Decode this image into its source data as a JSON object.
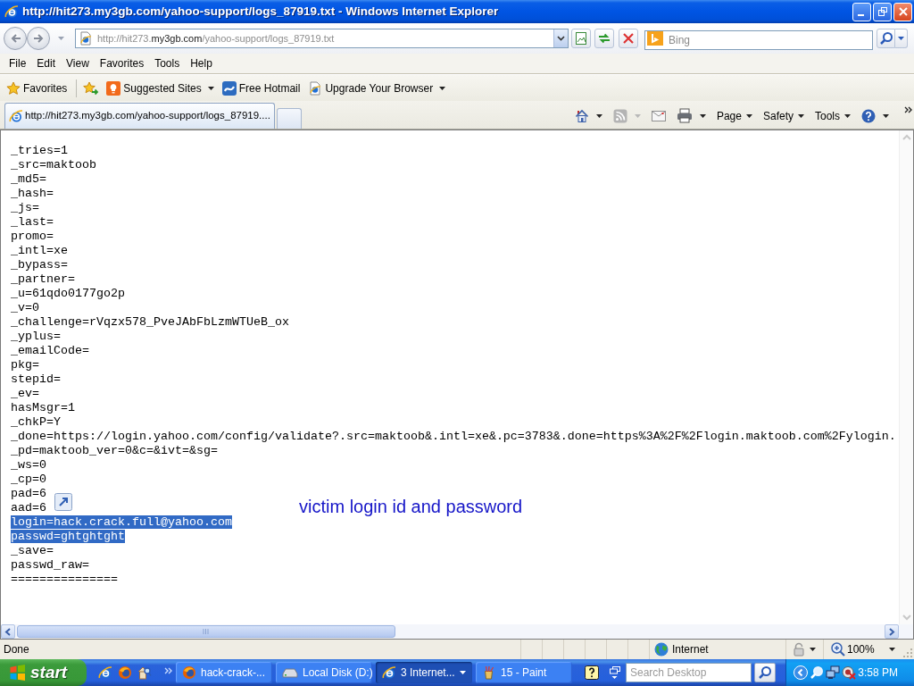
{
  "window": {
    "title": "http://hit273.my3gb.com/yahoo-support/logs_87919.txt - Windows Internet Explorer"
  },
  "address_bar": {
    "url": {
      "start": "http://hit273.",
      "domain": "my3gb.com",
      "end": "/yahoo-support/logs_87919.txt"
    }
  },
  "search": {
    "placeholder": "Bing"
  },
  "menu_bar": {
    "items": [
      "File",
      "Edit",
      "View",
      "Favorites",
      "Tools",
      "Help"
    ]
  },
  "favorites_bar": {
    "favorites": "Favorites",
    "links": [
      {
        "label": "Suggested Sites",
        "dropdown": true
      },
      {
        "label": "Free Hotmail",
        "dropdown": false
      },
      {
        "label": "Upgrade Your Browser",
        "dropdown": true
      }
    ]
  },
  "tabs": [
    {
      "label": "http://hit273.my3gb.com/yahoo-support/logs_87919....",
      "selected": true
    }
  ],
  "command_bar": {
    "items": [
      {
        "kind": "icon",
        "dropdown": true,
        "disabled": false
      },
      {
        "kind": "icon",
        "dropdown": true,
        "disabled": true
      },
      {
        "kind": "icon",
        "dropdown": false,
        "disabled": false
      },
      {
        "kind": "icon",
        "dropdown": true,
        "disabled": false
      },
      {
        "kind": "menu",
        "label": "Page",
        "dropdown": true,
        "disabled": false
      },
      {
        "kind": "menu",
        "label": "Safety",
        "dropdown": true,
        "disabled": false
      },
      {
        "kind": "menu",
        "label": "Tools",
        "dropdown": true,
        "disabled": false
      },
      {
        "kind": "icon",
        "dropdown": true,
        "disabled": false
      }
    ]
  },
  "document": {
    "lines": [
      {
        "text": "_tries=1",
        "selected": false
      },
      {
        "text": "_src=maktoob",
        "selected": false
      },
      {
        "text": "_md5=",
        "selected": false
      },
      {
        "text": "_hash=",
        "selected": false
      },
      {
        "text": "_js=",
        "selected": false
      },
      {
        "text": "_last=",
        "selected": false
      },
      {
        "text": "promo=",
        "selected": false
      },
      {
        "text": "_intl=xe",
        "selected": false
      },
      {
        "text": "_bypass=",
        "selected": false
      },
      {
        "text": "_partner=",
        "selected": false
      },
      {
        "text": "_u=61qdo0177go2p",
        "selected": false
      },
      {
        "text": "_v=0",
        "selected": false
      },
      {
        "text": "_challenge=rVqzx578_PveJAbFbLzmWTUeB_ox",
        "selected": false
      },
      {
        "text": "_yplus=",
        "selected": false
      },
      {
        "text": "_emailCode=",
        "selected": false
      },
      {
        "text": "pkg=",
        "selected": false
      },
      {
        "text": "stepid=",
        "selected": false
      },
      {
        "text": "_ev=",
        "selected": false
      },
      {
        "text": "hasMsgr=1",
        "selected": false
      },
      {
        "text": "_chkP=Y",
        "selected": false
      },
      {
        "text": "_done=https://login.yahoo.com/config/validate?.src=maktoob&.intl=xe&.pc=3783&.done=https%3A%2F%2Flogin.maktoob.com%2Fylogin.",
        "selected": false
      },
      {
        "text": "_pd=maktoob_ver=0&c=&ivt=&sg=",
        "selected": false
      },
      {
        "text": "_ws=0",
        "selected": false
      },
      {
        "text": "_cp=0",
        "selected": false
      },
      {
        "text": "pad=6",
        "selected": false
      },
      {
        "text": "aad=6",
        "selected": false
      },
      {
        "text": "login=hack.crack.full@yahoo.com",
        "selected": true
      },
      {
        "text": "passwd=ghtghtght",
        "selected": true
      },
      {
        "text": "_save=",
        "selected": false
      },
      {
        "text": "passwd_raw=",
        "selected": false
      },
      {
        "text": "===============",
        "selected": false
      }
    ],
    "annotation": "victim login id and password"
  },
  "status_bar": {
    "text": "Done",
    "zone": "Internet",
    "zoom": "100%"
  },
  "taskbar": {
    "start": "start",
    "tasks": [
      {
        "label": "hack-crack-...",
        "selected": false,
        "grouped": false
      },
      {
        "label": "Local Disk (D:)",
        "selected": false,
        "grouped": false
      },
      {
        "label": "3 Internet...",
        "selected": true,
        "grouped": true
      },
      {
        "label": "15 - Paint",
        "selected": false,
        "grouped": false
      }
    ],
    "search": {
      "placeholder": "Search Desktop"
    },
    "clock": "3:58 PM"
  }
}
